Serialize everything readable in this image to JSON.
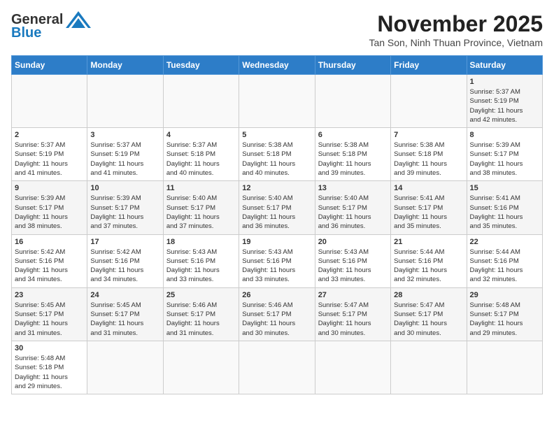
{
  "header": {
    "logo_general": "General",
    "logo_blue": "Blue",
    "month": "November 2025",
    "location": "Tan Son, Ninh Thuan Province, Vietnam"
  },
  "weekdays": [
    "Sunday",
    "Monday",
    "Tuesday",
    "Wednesday",
    "Thursday",
    "Friday",
    "Saturday"
  ],
  "weeks": [
    [
      {
        "day": "",
        "info": ""
      },
      {
        "day": "",
        "info": ""
      },
      {
        "day": "",
        "info": ""
      },
      {
        "day": "",
        "info": ""
      },
      {
        "day": "",
        "info": ""
      },
      {
        "day": "",
        "info": ""
      },
      {
        "day": "1",
        "info": "Sunrise: 5:37 AM\nSunset: 5:19 PM\nDaylight: 11 hours\nand 42 minutes."
      }
    ],
    [
      {
        "day": "2",
        "info": "Sunrise: 5:37 AM\nSunset: 5:19 PM\nDaylight: 11 hours\nand 41 minutes."
      },
      {
        "day": "3",
        "info": "Sunrise: 5:37 AM\nSunset: 5:19 PM\nDaylight: 11 hours\nand 41 minutes."
      },
      {
        "day": "4",
        "info": "Sunrise: 5:37 AM\nSunset: 5:18 PM\nDaylight: 11 hours\nand 40 minutes."
      },
      {
        "day": "5",
        "info": "Sunrise: 5:38 AM\nSunset: 5:18 PM\nDaylight: 11 hours\nand 40 minutes."
      },
      {
        "day": "6",
        "info": "Sunrise: 5:38 AM\nSunset: 5:18 PM\nDaylight: 11 hours\nand 39 minutes."
      },
      {
        "day": "7",
        "info": "Sunrise: 5:38 AM\nSunset: 5:18 PM\nDaylight: 11 hours\nand 39 minutes."
      },
      {
        "day": "8",
        "info": "Sunrise: 5:39 AM\nSunset: 5:17 PM\nDaylight: 11 hours\nand 38 minutes."
      }
    ],
    [
      {
        "day": "9",
        "info": "Sunrise: 5:39 AM\nSunset: 5:17 PM\nDaylight: 11 hours\nand 38 minutes."
      },
      {
        "day": "10",
        "info": "Sunrise: 5:39 AM\nSunset: 5:17 PM\nDaylight: 11 hours\nand 37 minutes."
      },
      {
        "day": "11",
        "info": "Sunrise: 5:40 AM\nSunset: 5:17 PM\nDaylight: 11 hours\nand 37 minutes."
      },
      {
        "day": "12",
        "info": "Sunrise: 5:40 AM\nSunset: 5:17 PM\nDaylight: 11 hours\nand 36 minutes."
      },
      {
        "day": "13",
        "info": "Sunrise: 5:40 AM\nSunset: 5:17 PM\nDaylight: 11 hours\nand 36 minutes."
      },
      {
        "day": "14",
        "info": "Sunrise: 5:41 AM\nSunset: 5:17 PM\nDaylight: 11 hours\nand 35 minutes."
      },
      {
        "day": "15",
        "info": "Sunrise: 5:41 AM\nSunset: 5:16 PM\nDaylight: 11 hours\nand 35 minutes."
      }
    ],
    [
      {
        "day": "16",
        "info": "Sunrise: 5:42 AM\nSunset: 5:16 PM\nDaylight: 11 hours\nand 34 minutes."
      },
      {
        "day": "17",
        "info": "Sunrise: 5:42 AM\nSunset: 5:16 PM\nDaylight: 11 hours\nand 34 minutes."
      },
      {
        "day": "18",
        "info": "Sunrise: 5:43 AM\nSunset: 5:16 PM\nDaylight: 11 hours\nand 33 minutes."
      },
      {
        "day": "19",
        "info": "Sunrise: 5:43 AM\nSunset: 5:16 PM\nDaylight: 11 hours\nand 33 minutes."
      },
      {
        "day": "20",
        "info": "Sunrise: 5:43 AM\nSunset: 5:16 PM\nDaylight: 11 hours\nand 33 minutes."
      },
      {
        "day": "21",
        "info": "Sunrise: 5:44 AM\nSunset: 5:16 PM\nDaylight: 11 hours\nand 32 minutes."
      },
      {
        "day": "22",
        "info": "Sunrise: 5:44 AM\nSunset: 5:16 PM\nDaylight: 11 hours\nand 32 minutes."
      }
    ],
    [
      {
        "day": "23",
        "info": "Sunrise: 5:45 AM\nSunset: 5:17 PM\nDaylight: 11 hours\nand 31 minutes."
      },
      {
        "day": "24",
        "info": "Sunrise: 5:45 AM\nSunset: 5:17 PM\nDaylight: 11 hours\nand 31 minutes."
      },
      {
        "day": "25",
        "info": "Sunrise: 5:46 AM\nSunset: 5:17 PM\nDaylight: 11 hours\nand 31 minutes."
      },
      {
        "day": "26",
        "info": "Sunrise: 5:46 AM\nSunset: 5:17 PM\nDaylight: 11 hours\nand 30 minutes."
      },
      {
        "day": "27",
        "info": "Sunrise: 5:47 AM\nSunset: 5:17 PM\nDaylight: 11 hours\nand 30 minutes."
      },
      {
        "day": "28",
        "info": "Sunrise: 5:47 AM\nSunset: 5:17 PM\nDaylight: 11 hours\nand 30 minutes."
      },
      {
        "day": "29",
        "info": "Sunrise: 5:48 AM\nSunset: 5:17 PM\nDaylight: 11 hours\nand 29 minutes."
      }
    ],
    [
      {
        "day": "30",
        "info": "Sunrise: 5:48 AM\nSunset: 5:18 PM\nDaylight: 11 hours\nand 29 minutes."
      },
      {
        "day": "",
        "info": ""
      },
      {
        "day": "",
        "info": ""
      },
      {
        "day": "",
        "info": ""
      },
      {
        "day": "",
        "info": ""
      },
      {
        "day": "",
        "info": ""
      },
      {
        "day": "",
        "info": ""
      }
    ]
  ]
}
